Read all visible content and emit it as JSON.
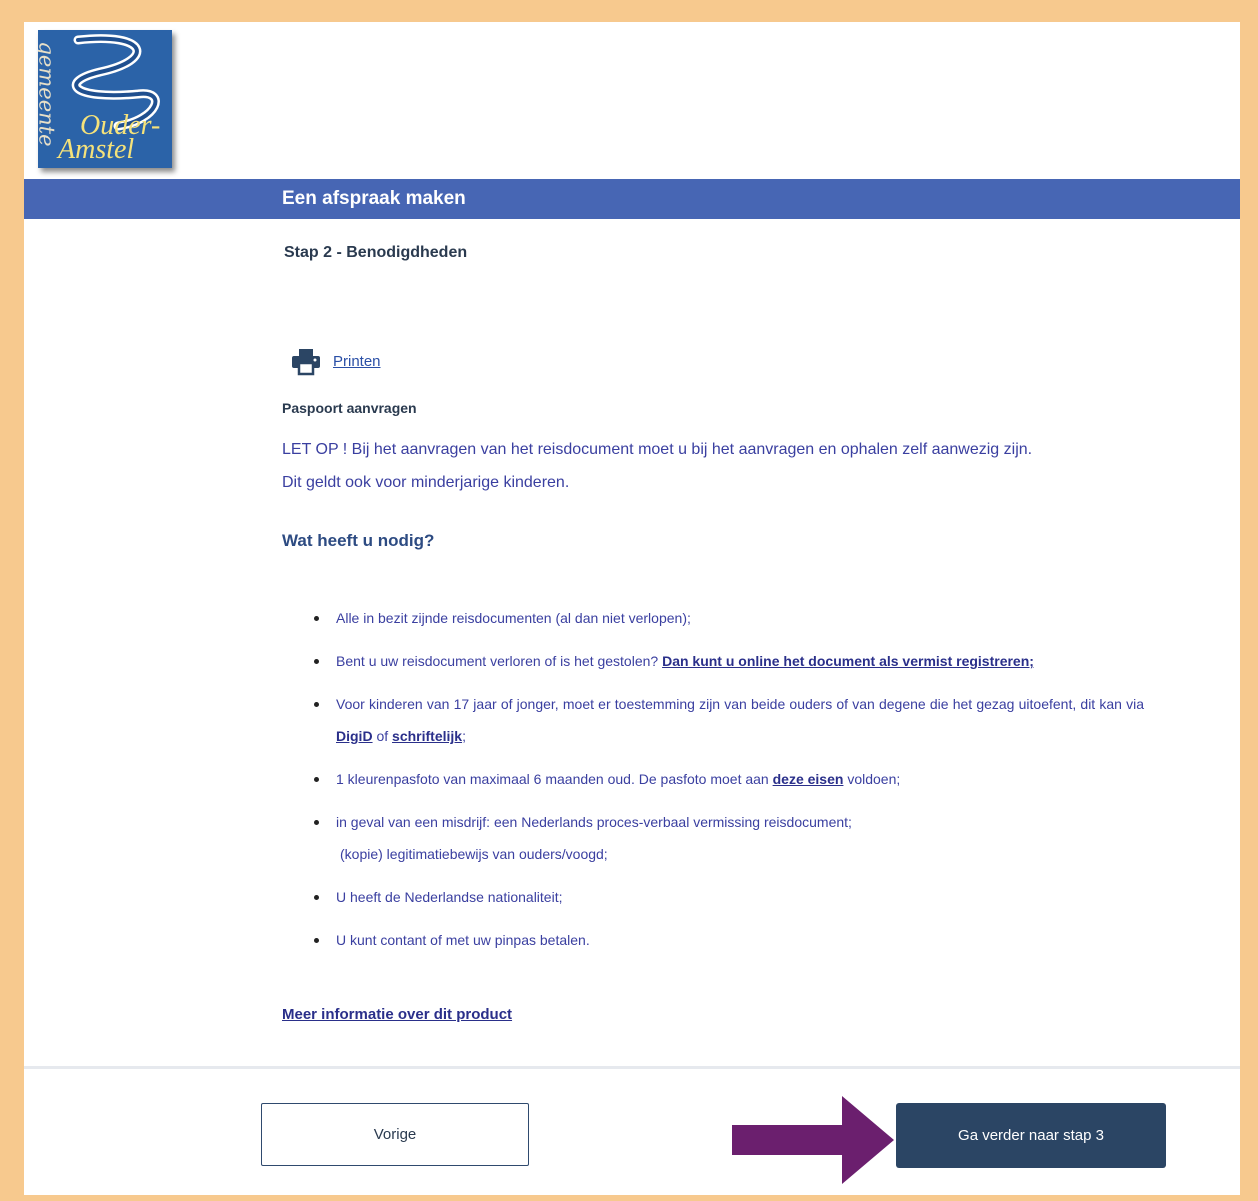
{
  "logo": {
    "line_vertical": "gemeente",
    "line1": "Ouder-",
    "line2": "Amstel"
  },
  "header": {
    "title": "Een afspraak maken"
  },
  "step_title": "Stap 2 - Benodigdheden",
  "print": {
    "icon": "printer-icon",
    "label": "Printen"
  },
  "product": {
    "title": "Paspoort aanvragen",
    "warning_line1": "LET OP ! Bij het aanvragen van het reisdocument moet u bij het aanvragen en ophalen zelf aanwezig zijn.",
    "warning_line2": "Dit geldt ook voor minderjarige kinderen."
  },
  "needs": {
    "title": "Wat heeft u nodig?",
    "item1": "Alle in bezit zijnde reisdocumenten (al dan niet verlopen);",
    "item2_text": "Bent u uw reisdocument verloren of is het gestolen?",
    "item2_link": "Dan kunt u online het document als vermist registreren;",
    "item3_text": "Voor kinderen van 17 jaar of jonger, moet er toestemming zijn van beide ouders of van degene die het gezag uitoefent, dit kan via",
    "item3_link1": "DigiD",
    "item3_mid": "of",
    "item3_link2": "schriftelijk",
    "item3_end": ";",
    "item4_text": "1 kleurenpasfoto van maximaal 6 maanden oud. De pasfoto moet aan",
    "item4_link": "deze eisen",
    "item4_end": "voldoen;",
    "item5_line1": "in geval van een misdrijf: een Nederlands proces-verbaal vermissing reisdocument;",
    "item5_line2": "(kopie) legitimatiebewijs van ouders/voogd;",
    "item6": "U heeft de Nederlandse nationaliteit;",
    "item7": "U kunt contant of met uw pinpas betalen."
  },
  "more_info_link": "Meer informatie over dit product",
  "footer": {
    "prev_label": "Vorige",
    "next_label": "Ga verder naar stap 3"
  },
  "colors": {
    "frame": "#f7c98e",
    "header_bar": "#4766b4",
    "next_button": "#2b4564",
    "annotation_arrow": "#6b1f6e"
  }
}
